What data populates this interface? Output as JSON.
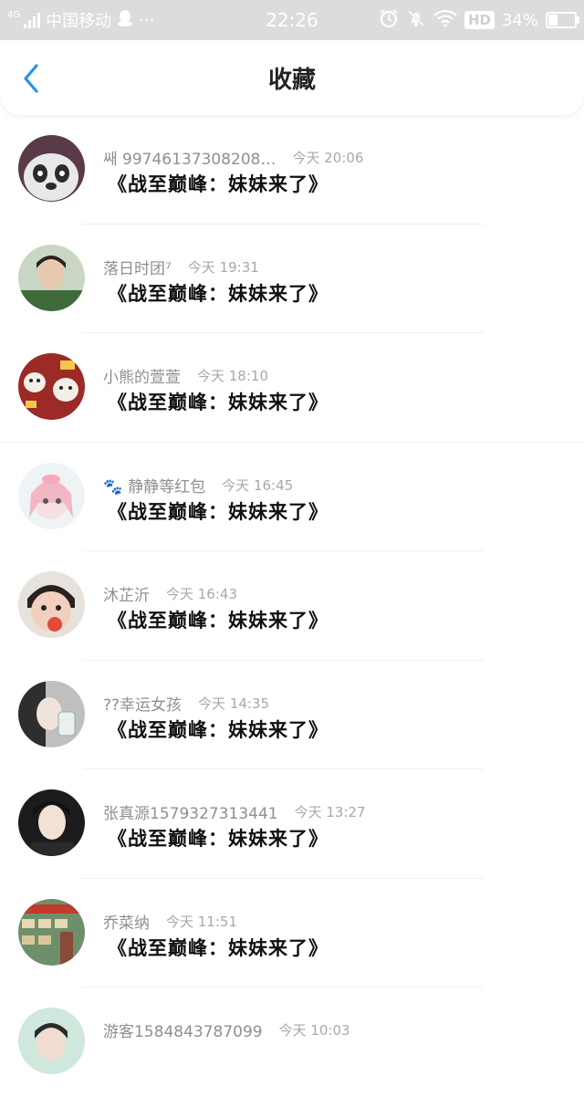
{
  "status_bar": {
    "network": "4G",
    "carrier": "中国移动",
    "more": "···",
    "time": "22:26",
    "hd": "HD",
    "battery": "34%",
    "battery_level": 0.34
  },
  "header": {
    "title": "收藏"
  },
  "message_text": "《战至巅峰：妹妹来了》",
  "items": [
    {
      "nickname": "쌔 99746137308208…",
      "time": "今天 20:06",
      "message": "《战至巅峰：妹妹来了》"
    },
    {
      "nickname": "落日时团⁷",
      "time": "今天 19:31",
      "message": "《战至巅峰：妹妹来了》"
    },
    {
      "nickname": "小熊的萱萱",
      "time": "今天 18:10",
      "message": "《战至巅峰：妹妹来了》"
    },
    {
      "nickname": "静静等红包",
      "time": "今天 16:45",
      "message": "《战至巅峰：妹妹来了》"
    },
    {
      "nickname": "沐芷沂",
      "time": "今天 16:43",
      "message": "《战至巅峰：妹妹来了》"
    },
    {
      "nickname": "??幸运女孩",
      "time": "今天 14:35",
      "message": "《战至巅峰：妹妹来了》"
    },
    {
      "nickname": "张真源15793273134​41",
      "time": "今天 13:27",
      "message": "《战至巅峰：妹妹来了》"
    },
    {
      "nickname": "乔菜纳",
      "time": "今天 11:51",
      "message": "《战至巅峰：妹妹来了》"
    },
    {
      "nickname": "游客1584843787099",
      "time": "今天 10:03",
      "message": ""
    }
  ],
  "colors": {
    "accent": "#2b93e8",
    "status_bar_bg": "#dcdcdc",
    "nick_color": "#8f8f8f",
    "message_color": "#111111"
  }
}
